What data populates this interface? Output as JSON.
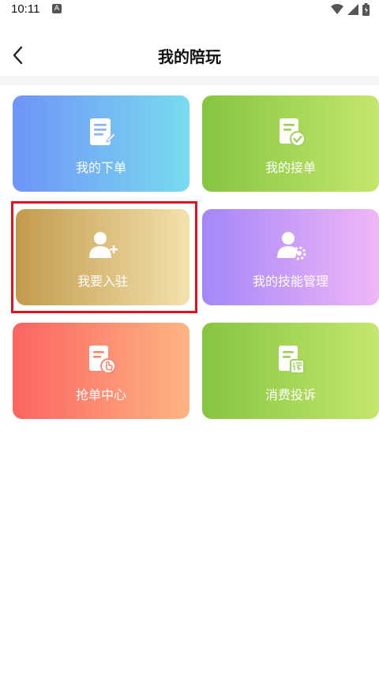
{
  "statusbar": {
    "time": "10:11",
    "notification_badge": "A"
  },
  "header": {
    "title": "我的陪玩"
  },
  "menu": {
    "items": [
      {
        "label": "我的下单",
        "icon": "document-list-icon",
        "gradient": [
          "#6f94f8",
          "#78dbef"
        ]
      },
      {
        "label": "我的接单",
        "icon": "document-check-icon",
        "gradient": [
          "#86c53f",
          "#c4e76d"
        ]
      },
      {
        "label": "我要入驻",
        "icon": "user-add-icon",
        "gradient": [
          "#c39b4c",
          "#f3e1ad"
        ]
      },
      {
        "label": "我的技能管理",
        "icon": "user-settings-icon",
        "gradient": [
          "#a487f7",
          "#f1b6f8"
        ]
      },
      {
        "label": "抢单中心",
        "icon": "document-tap-icon",
        "gradient": [
          "#fb6462",
          "#feb583"
        ]
      },
      {
        "label": "消费投诉",
        "icon": "document-complaint-icon",
        "gradient": [
          "#86c53f",
          "#c4e76d"
        ]
      }
    ]
  },
  "highlight_color": "#e3101b"
}
